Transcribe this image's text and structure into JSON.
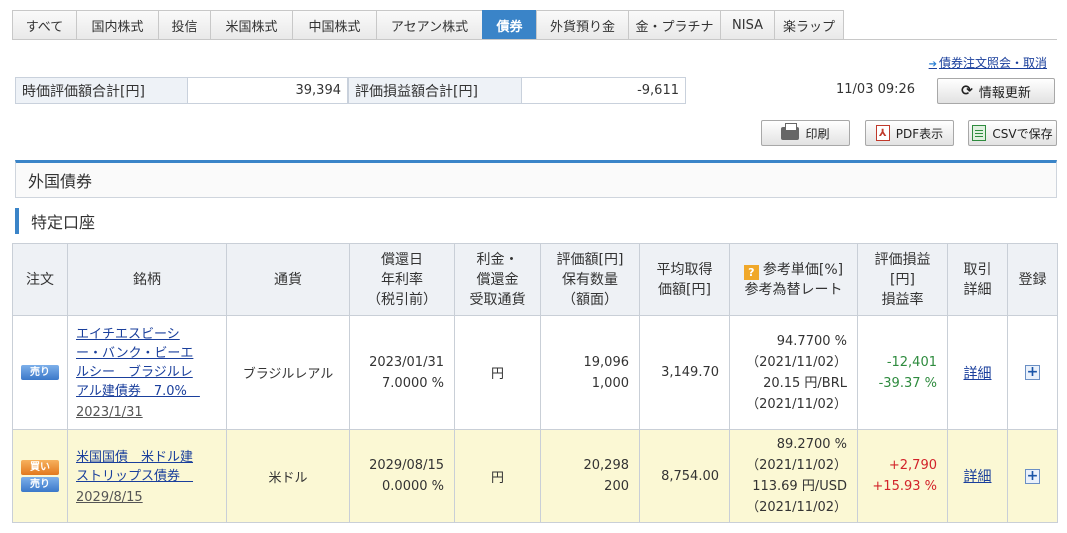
{
  "tabs": [
    {
      "label": "すべて",
      "w": 64
    },
    {
      "label": "国内株式",
      "w": 82
    },
    {
      "label": "投信",
      "w": 52
    },
    {
      "label": "米国株式",
      "w": 82
    },
    {
      "label": "中国株式",
      "w": 84
    },
    {
      "label": "アセアン株式",
      "w": 106
    },
    {
      "label": "債券",
      "w": 54,
      "active": true
    },
    {
      "label": "外貨預り金",
      "w": 92
    },
    {
      "label": "金・プラチナ",
      "w": 92
    },
    {
      "label": "NISA",
      "w": 54
    },
    {
      "label": "楽ラップ",
      "w": 70
    }
  ],
  "order_link": "債券注文照会・取消",
  "summary": {
    "valuation_label": "時価評価額合計[円]",
    "valuation_value": "39,394",
    "pl_label": "評価損益額合計[円]",
    "pl_value": "-9,611"
  },
  "timestamp": "11/03 09:26",
  "buttons": {
    "refresh": "情報更新",
    "print": "印刷",
    "pdf": "PDF表示",
    "csv": "CSVで保存"
  },
  "section_title": "外国債券",
  "account_title": "特定口座",
  "table": {
    "headers": {
      "order": "注文",
      "name": "銘柄",
      "currency": "通貨",
      "maturity_1": "償還日",
      "maturity_2": "年利率",
      "maturity_3": "（税引前）",
      "interest_1": "利金・",
      "interest_2": "償還金",
      "interest_3": "受取通貨",
      "value_1": "評価額[円]",
      "value_2": "保有数量",
      "value_3": "（額面）",
      "avg_1": "平均取得",
      "avg_2": "価額[円]",
      "ref_1": "参考単価[%]",
      "ref_2": "参考為替レート",
      "pl_1": "評価損益",
      "pl_2": "[円]",
      "pl_3": "損益率",
      "detail_1": "取引",
      "detail_2": "詳細",
      "register": "登録"
    },
    "rows": [
      {
        "sell": "売り",
        "name_lines": [
          "エイチエスビーシ",
          "ー・バンク・ビーエ",
          "ルシー　ブラジルレ",
          "アル建債券　7.0%　"
        ],
        "name_date": "2023/1/31",
        "currency": "ブラジルレアル",
        "maturity": "2023/01/31",
        "rate": "7.0000 %",
        "receive": "円",
        "value": "19,096",
        "qty": "1,000",
        "avg": "3,149.70",
        "ref_price": "94.7700 %",
        "ref_date1": "（2021/11/02）",
        "fx": "20.15 円/BRL",
        "ref_date2": "（2021/11/02）",
        "pl": "-12,401",
        "pl_rate": "-39.37 %",
        "detail": "詳細"
      },
      {
        "buy": "買い",
        "sell": "売り",
        "name_lines": [
          "米国国債　米ドル建",
          "ストリップス債券　"
        ],
        "name_date": "2029/8/15",
        "currency": "米ドル",
        "maturity": "2029/08/15",
        "rate": "0.0000 %",
        "receive": "円",
        "value": "20,298",
        "qty": "200",
        "avg": "8,754.00",
        "ref_price": "89.2700 %",
        "ref_date1": "（2021/11/02）",
        "fx": "113.69 円/USD",
        "ref_date2": "（2021/11/02）",
        "pl": "+2,790",
        "pl_rate": "+15.93 %",
        "detail": "詳細"
      }
    ]
  },
  "colors": {
    "accent": "#3a84c8",
    "positive": "#d2232a",
    "negative": "#2e8b3e",
    "highlight_row": "#fbf8d4"
  }
}
